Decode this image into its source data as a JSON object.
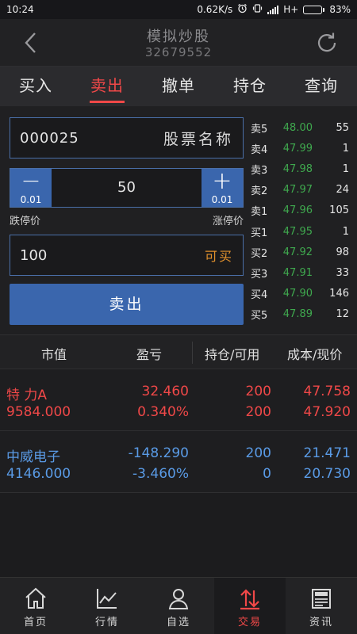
{
  "status_bar": {
    "time": "10:24",
    "speed": "0.62K/s",
    "network": "H+",
    "battery": "83%",
    "battery_level": 0.83
  },
  "header": {
    "title": "模拟炒股",
    "account": "32679552"
  },
  "tabs": [
    {
      "label": "买入",
      "active": false
    },
    {
      "label": "卖出",
      "active": true
    },
    {
      "label": "撤单",
      "active": false
    },
    {
      "label": "持仓",
      "active": false
    },
    {
      "label": "查询",
      "active": false
    }
  ],
  "form": {
    "stock_code": "000025",
    "stock_name_label": "股票名称",
    "decrement_symbol": "−",
    "increment_symbol": "+",
    "decrement_step": "0.01",
    "increment_step": "0.01",
    "quantity": "50",
    "limit_down_label": "跌停价",
    "limit_up_label": "涨停价",
    "price_value": "100",
    "price_hint": "可买",
    "submit_label": "卖出"
  },
  "order_book": {
    "asks": [
      {
        "label": "卖5",
        "price": "48.00",
        "volume": "55"
      },
      {
        "label": "卖4",
        "price": "47.99",
        "volume": "1"
      },
      {
        "label": "卖3",
        "price": "47.98",
        "volume": "1"
      },
      {
        "label": "卖2",
        "price": "47.97",
        "volume": "24"
      },
      {
        "label": "卖1",
        "price": "47.96",
        "volume": "105"
      }
    ],
    "bids": [
      {
        "label": "买1",
        "price": "47.95",
        "volume": "1"
      },
      {
        "label": "买2",
        "price": "47.92",
        "volume": "98"
      },
      {
        "label": "买3",
        "price": "47.91",
        "volume": "33"
      },
      {
        "label": "买4",
        "price": "47.90",
        "volume": "146"
      },
      {
        "label": "买5",
        "price": "47.89",
        "volume": "12"
      }
    ],
    "price_color": "#3fa84e"
  },
  "positions": {
    "headers": {
      "market_value": "市值",
      "pnl": "盈亏",
      "holding": "持仓/可用",
      "cost": "成本/现价"
    },
    "rows": [
      {
        "name": "特 力A",
        "market_value": "9584.000",
        "pnl": "32.460",
        "pnl_pct": "0.340%",
        "holding": "200",
        "available": "200",
        "cost": "47.758",
        "price": "47.920",
        "color": "#f04848"
      },
      {
        "name": "中威电子",
        "market_value": "4146.000",
        "pnl": "-148.290",
        "pnl_pct": "-3.460%",
        "holding": "200",
        "available": "0",
        "cost": "21.471",
        "price": "20.730",
        "color": "#5a9be6"
      }
    ]
  },
  "bottom_nav": [
    {
      "label": "首页",
      "icon": "home-icon",
      "active": false
    },
    {
      "label": "行情",
      "icon": "chart-icon",
      "active": false
    },
    {
      "label": "自选",
      "icon": "person-icon",
      "active": false
    },
    {
      "label": "交易",
      "icon": "trade-icon",
      "active": true
    },
    {
      "label": "资讯",
      "icon": "news-icon",
      "active": false
    }
  ],
  "colors": {
    "accent_red": "#f04848",
    "accent_blue": "#3a66ad",
    "hint_orange": "#e0902c"
  }
}
